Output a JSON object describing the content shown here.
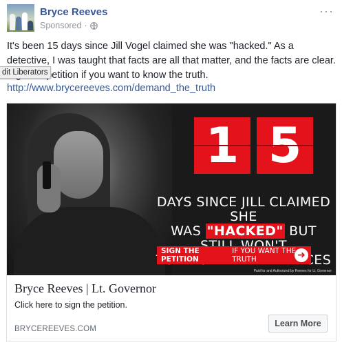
{
  "post": {
    "page_name": "Bryce Reeves",
    "sponsored_label": "Sponsored",
    "separator": "·",
    "more_glyph": "···",
    "body_text": "It's been 15 days since Jill Vogel claimed she was \"hacked.\" As a detective, I was taught that facts are all that matter, and the facts are clear. Sign the petition if you want to know the truth.",
    "link_url": "http://www.brycereeves.com/demand_the_truth"
  },
  "tooltip": {
    "text": "dit Liberators"
  },
  "ad_image": {
    "digit_1": "1",
    "digit_2": "5",
    "headline_line1": "DAYS SINCE JILL CLAIMED SHE",
    "headline_was": "WAS ",
    "headline_hacked": "\"HACKED\"",
    "headline_rest": " BUT STILL WON'T",
    "headline_line3": "TURN OVER HER DEVICES",
    "petition_bold": "SIGN THE PETITION",
    "petition_thin": "IF YOU WANT THE TRUTH",
    "disclaimer": "Paid for and Authorized by Reeves for Lt. Governor",
    "accent_color": "#e3121b"
  },
  "card": {
    "title": "Bryce Reeves | Lt. Governor",
    "description": "Click here to sign the petition.",
    "domain": "BRYCEREEVES.COM",
    "cta_label": "Learn More"
  },
  "icons": {
    "globe": "globe-icon",
    "more": "more-options-icon",
    "arrow": "arrow-right-circle-icon"
  }
}
